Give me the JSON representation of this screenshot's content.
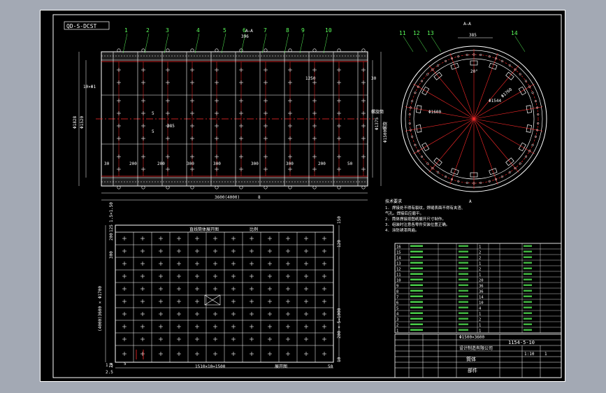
{
  "drawing_code": "QD-S-DCST",
  "balloons": [
    "1",
    "2",
    "3",
    "4",
    "5",
    "6",
    "7",
    "8",
    "9",
    "10",
    "11",
    "12",
    "13",
    "14"
  ],
  "side_view": {
    "section_label": "A—A",
    "dims": {
      "left_outer": "Φ1828",
      "left_inner": "Φ1520",
      "right_outer": "Φ1375",
      "right_inner": "Φ1500螺旋",
      "vertical_1": "10×Φ1",
      "top_small": "396",
      "pitch_inner": "285",
      "span_1250": "1250",
      "bottom_total": "3600(4000)",
      "bottom_right": "8",
      "tick_30": "30"
    },
    "bottom_pitch_labels": [
      "30",
      "200",
      "200",
      "300",
      "300",
      "300",
      "300",
      "200",
      "50"
    ],
    "rib_labels": [
      "5",
      "5"
    ],
    "right_note": "螺旋筒"
  },
  "end_view": {
    "title": "A—A",
    "dim_top": "385",
    "dim_d1": "Φ1600",
    "dim_d2": "Φ1544",
    "dim_r": "Φ1760",
    "angle": "20°",
    "bottom_mark": "A"
  },
  "plan_view": {
    "header_left": "直线筒体展开图",
    "header_right": "比例",
    "left_dims": [
      "300",
      "200",
      "125",
      "1.5×1.50",
      "20"
    ],
    "left_total": "(4000)3600 × Φ1700",
    "right_dims": [
      "150",
      "120",
      "200 × 5=1000",
      "10"
    ],
    "bottom_dims": [
      "1.5",
      "5",
      "1510×10=1500",
      "2.5"
    ],
    "bottom_label": "展开图",
    "bottom_right": "50"
  },
  "notes": {
    "title": "技术要求",
    "lines": [
      "1. 焊接处不得有裂纹，焊缝表面不得有夹渣、",
      "   气孔。焊接后应磨平。",
      "2. 筒体焊接按图纸展开尺寸制作。",
      "3. 组装时注意各零件安装位置正确。",
      "4. 涂防锈漆两遍。"
    ]
  },
  "bom": {
    "rows": [
      [
        "16",
        "",
        "",
        "",
        "1",
        "",
        "",
        "",
        ""
      ],
      [
        "15",
        "",
        "",
        "",
        "2",
        "",
        "",
        "",
        ""
      ],
      [
        "14",
        "",
        "",
        "",
        "2",
        "",
        "",
        "",
        ""
      ],
      [
        "13",
        "",
        "",
        "",
        "1",
        "",
        "",
        "",
        ""
      ],
      [
        "12",
        "",
        "",
        "",
        "2",
        "",
        "",
        "",
        ""
      ],
      [
        "11",
        "",
        "",
        "",
        "1",
        "",
        "",
        "",
        ""
      ],
      [
        "10",
        "",
        "",
        "",
        "20",
        "",
        "",
        "",
        ""
      ],
      [
        "9",
        "",
        "",
        "",
        "36",
        "",
        "",
        "",
        ""
      ],
      [
        "8",
        "",
        "",
        "",
        "36",
        "",
        "",
        "",
        ""
      ],
      [
        "7",
        "",
        "",
        "",
        "14",
        "",
        "",
        "",
        ""
      ],
      [
        "6",
        "",
        "",
        "",
        "10",
        "",
        "",
        "",
        ""
      ],
      [
        "5",
        "",
        "",
        "",
        "4",
        "",
        "",
        "",
        ""
      ],
      [
        "4",
        "",
        "",
        "",
        "1",
        "",
        "",
        "",
        ""
      ],
      [
        "3",
        "",
        "",
        "",
        "2",
        "",
        "",
        "",
        ""
      ],
      [
        "2",
        "",
        "",
        "",
        "1",
        "",
        "",
        "",
        ""
      ],
      [
        "1",
        "",
        "",
        "",
        "1",
        "",
        "",
        "",
        ""
      ]
    ]
  },
  "title_block": {
    "spec": "Φ1500×3600",
    "drawing_no": "1154-5-10",
    "company": "设计制造有限公司",
    "part_name": "筒体",
    "assembly": "部件",
    "scale": "1:10",
    "sheet": "1"
  },
  "colors": {
    "line": "#ffffff",
    "center": "#ff2a2a",
    "accent": "#5bff5b",
    "dim": "#ffff66",
    "frame_bg": "#000000",
    "outer_bg": "#a3a9b4"
  }
}
